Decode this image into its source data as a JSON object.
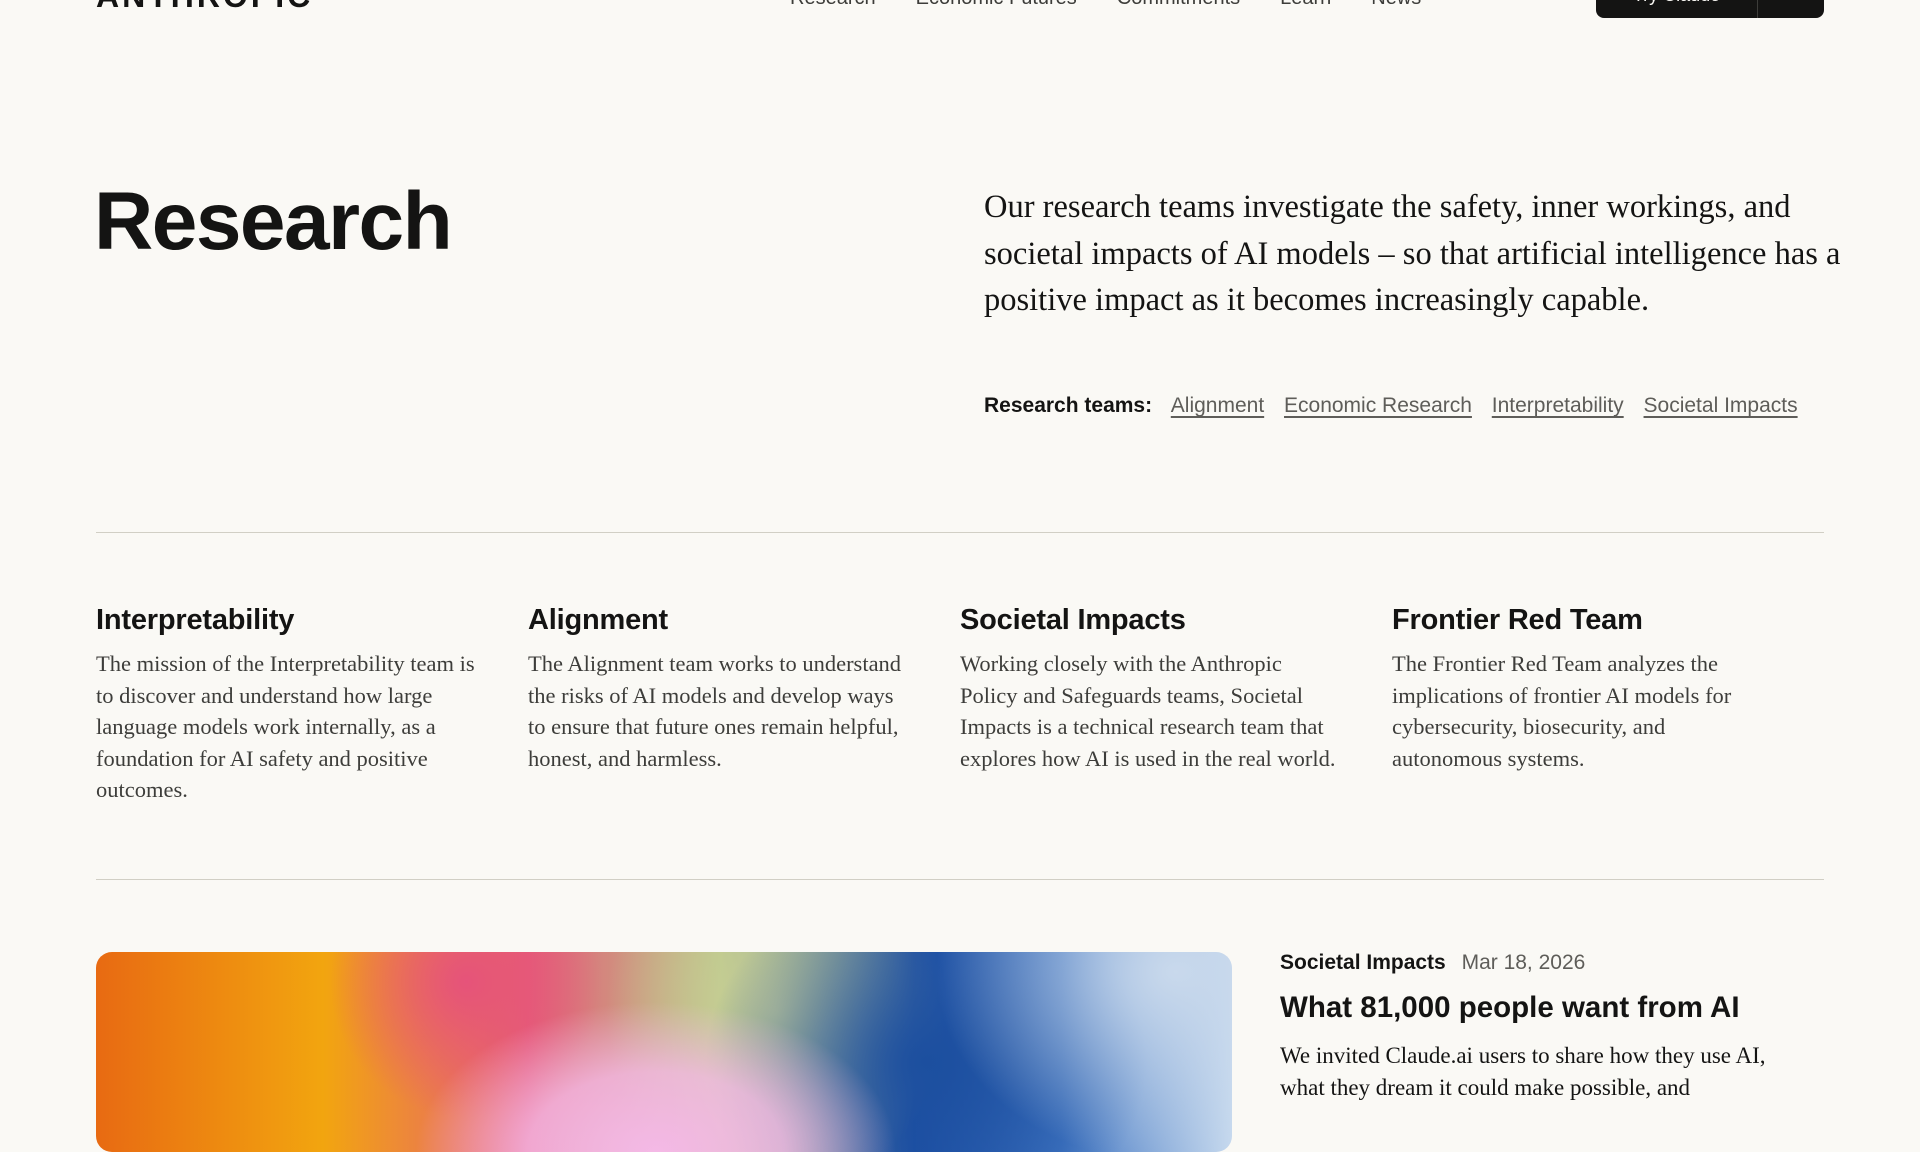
{
  "nav": {
    "logo": "ANTHROPIC",
    "links": [
      "Research",
      "Economic Futures",
      "Commitments",
      "Learn",
      "News"
    ],
    "cta_label": "Try Claude"
  },
  "hero": {
    "title": "Research",
    "intro": "Our research teams investigate the safety, inner workings, and societal impacts of AI models – so that artificial intelligence has a positive impact as it becomes increasingly capable.",
    "teams_label": "Research teams:",
    "teams": [
      "Alignment",
      "Economic Research",
      "Interpretability",
      "Societal Impacts"
    ]
  },
  "cards": [
    {
      "title": "Interpretability",
      "body": "The mission of the Interpretability team is to discover and understand how large language models work internally, as a foundation for AI safety and positive outcomes."
    },
    {
      "title": "Alignment",
      "body": "The Alignment team works to understand the risks of AI models and develop ways to ensure that future ones remain helpful, honest, and harmless."
    },
    {
      "title": "Societal Impacts",
      "body": "Working closely with the Anthropic Policy and Safeguards teams, Societal Impacts is a technical research team that explores how AI is used in the real world."
    },
    {
      "title": "Frontier Red Team",
      "body": "The Frontier Red Team analyzes the implications of frontier AI models for cybersecurity, biosecurity, and autonomous systems."
    }
  ],
  "featured": {
    "category": "Societal Impacts",
    "date": "Mar 18, 2026",
    "title": "What 81,000 people want from AI",
    "excerpt": "We invited Claude.ai users to share how they use AI, what they dream it could make possible, and"
  }
}
